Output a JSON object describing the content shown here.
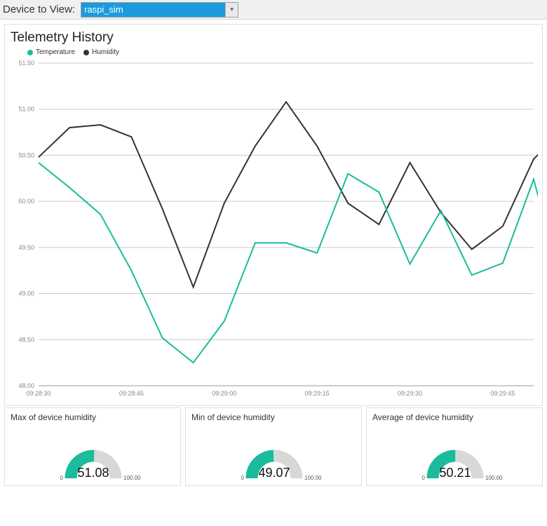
{
  "top": {
    "label": "Device to View:",
    "selected": "raspi_sim"
  },
  "history": {
    "title": "Telemetry History",
    "legend": [
      {
        "name": "Temperature",
        "color": "#1abc9c"
      },
      {
        "name": "Humidity",
        "color": "#333333"
      }
    ]
  },
  "chart_data": {
    "type": "line",
    "xlabel": "",
    "ylabel": "",
    "ylim": [
      48.0,
      51.5
    ],
    "y_ticks": [
      "48.00",
      "48.50",
      "49.00",
      "49.50",
      "50.00",
      "50.50",
      "51.00",
      "51.50"
    ],
    "x_ticks": [
      "09:28:30",
      "09:28:45",
      "09:29:00",
      "09:29:15",
      "09:29:30",
      "09:29:45"
    ],
    "x": [
      0,
      1,
      2,
      3,
      4,
      5,
      6,
      7,
      8,
      9,
      10,
      11,
      12,
      13,
      14,
      15,
      16
    ],
    "series": [
      {
        "name": "Temperature",
        "color": "#1abc9c",
        "values": [
          50.42,
          50.15,
          49.86,
          49.25,
          48.52,
          48.25,
          48.7,
          49.55,
          49.55,
          49.44,
          50.3,
          50.1,
          49.32,
          49.9,
          49.2,
          49.33,
          50.24
        ]
      },
      {
        "name": "Humidity",
        "color": "#333333",
        "values": [
          50.48,
          50.8,
          50.83,
          50.7,
          49.92,
          49.07,
          49.98,
          50.6,
          51.08,
          50.6,
          49.98,
          49.75,
          50.42,
          49.88,
          49.48,
          49.73,
          50.46
        ]
      }
    ],
    "extra_tail": {
      "Temperature": 49.48,
      "Humidity": 50.66
    }
  },
  "gauges": [
    {
      "title": "Max of device humidity",
      "value": "51.08",
      "min": "0",
      "max": "100.00",
      "pct": 51.08,
      "color": "#1abc9c"
    },
    {
      "title": "Min of device humidity",
      "value": "49.07",
      "min": "0",
      "max": "100.00",
      "pct": 49.07,
      "color": "#1abc9c"
    },
    {
      "title": "Average of device humidity",
      "value": "50.21",
      "min": "0",
      "max": "100.00",
      "pct": 50.21,
      "color": "#1abc9c"
    }
  ]
}
